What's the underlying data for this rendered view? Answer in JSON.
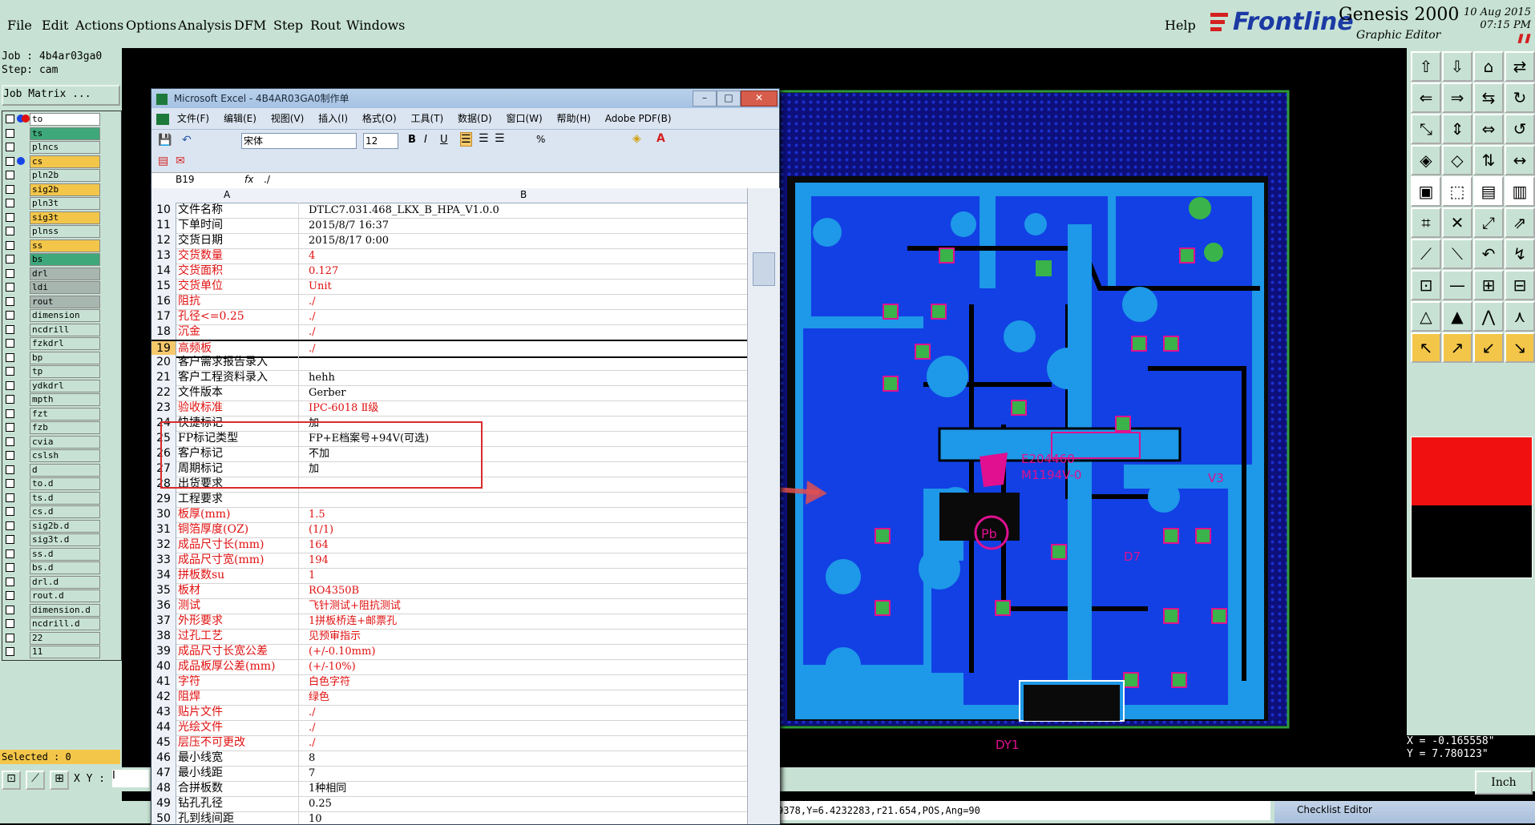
{
  "menubar": {
    "items": [
      "File",
      "Edit",
      "Actions",
      "Options",
      "Analysis",
      "DFM",
      "Step",
      "Rout",
      "Windows"
    ],
    "help": "Help",
    "brand": "Frontline",
    "product": "Genesis 2000",
    "subtitle": "Graphic Editor",
    "date": "10 Aug 2015",
    "time": "07:15 PM"
  },
  "left": {
    "job": "Job : 4b4ar03ga0",
    "step": "Step: cam",
    "job_matrix": "Job Matrix ...",
    "selected": "Selected : 0",
    "layers": [
      {
        "name": "to",
        "color": "#ffffff",
        "dot1": "#1846e6",
        "dot2": "#e01010"
      },
      {
        "name": "ts",
        "color": "#3fa87a"
      },
      {
        "name": "plncs",
        "color": "#c7e2d4"
      },
      {
        "name": "cs",
        "color": "#f3c64a",
        "dot1": "#1846e6"
      },
      {
        "name": "pln2b",
        "color": "#c7e2d4"
      },
      {
        "name": "sig2b",
        "color": "#f3c64a"
      },
      {
        "name": "pln3t",
        "color": "#c7e2d4"
      },
      {
        "name": "sig3t",
        "color": "#f3c64a"
      },
      {
        "name": "plnss",
        "color": "#c7e2d4"
      },
      {
        "name": "ss",
        "color": "#f3c64a"
      },
      {
        "name": "bs",
        "color": "#3fa87a"
      },
      {
        "name": "drl",
        "color": "#a8b6b0"
      },
      {
        "name": "ldi",
        "color": "#a8b6b0"
      },
      {
        "name": "rout",
        "color": "#a8b6b0"
      },
      {
        "name": "dimension",
        "color": "#c7e2d4"
      },
      {
        "name": "ncdrill",
        "color": "#c7e2d4"
      },
      {
        "name": "fzkdrl",
        "color": "#c7e2d4"
      },
      {
        "name": "bp",
        "color": "#c7e2d4"
      },
      {
        "name": "tp",
        "color": "#c7e2d4"
      },
      {
        "name": "ydkdrl",
        "color": "#c7e2d4"
      },
      {
        "name": "mpth",
        "color": "#c7e2d4"
      },
      {
        "name": "fzt",
        "color": "#c7e2d4"
      },
      {
        "name": "fzb",
        "color": "#c7e2d4"
      },
      {
        "name": "cvia",
        "color": "#c7e2d4"
      },
      {
        "name": "cslsh",
        "color": "#c7e2d4"
      },
      {
        "name": "d",
        "color": "#c7e2d4"
      },
      {
        "name": "to.d",
        "color": "#c7e2d4"
      },
      {
        "name": "ts.d",
        "color": "#c7e2d4"
      },
      {
        "name": "cs.d",
        "color": "#c7e2d4"
      },
      {
        "name": "sig2b.d",
        "color": "#c7e2d4"
      },
      {
        "name": "sig3t.d",
        "color": "#c7e2d4"
      },
      {
        "name": "ss.d",
        "color": "#c7e2d4"
      },
      {
        "name": "bs.d",
        "color": "#c7e2d4"
      },
      {
        "name": "drl.d",
        "color": "#c7e2d4"
      },
      {
        "name": "rout.d",
        "color": "#c7e2d4"
      },
      {
        "name": "dimension.d",
        "color": "#c7e2d4"
      },
      {
        "name": "ncdrill.d",
        "color": "#c7e2d4"
      },
      {
        "name": "22",
        "color": "#c7e2d4"
      },
      {
        "name": "11",
        "color": "#c7e2d4"
      }
    ]
  },
  "xy": {
    "label": "X Y :",
    "value": "I"
  },
  "coords": {
    "x": "X = -0.165558\"",
    "y": "Y = 7.780123\""
  },
  "units": "Inch",
  "cmdline": "9378,Y=6.4232283,r21.654,POS,Ang=90",
  "checklist_title": "Checklist Editor",
  "pcb": {
    "labels": [
      "E204460",
      "M1194V-0",
      "V3",
      "D7",
      "DY1"
    ]
  },
  "excel": {
    "title": "Microsoft Excel - 4B4AR03GA0制作单",
    "menus": [
      "文件(F)",
      "编辑(E)",
      "视图(V)",
      "插入(I)",
      "格式(O)",
      "工具(T)",
      "数据(D)",
      "窗口(W)",
      "帮助(H)",
      "Adobe PDF(B)"
    ],
    "font": "宋体",
    "size": "12",
    "cellref": "B19",
    "formula": "./",
    "col_a": "A",
    "col_b": "B",
    "rows": [
      {
        "n": "10",
        "a": "文件名称",
        "b": "DTLC7.031.468_LKX_B_HPA_V1.0.0",
        "red": false
      },
      {
        "n": "11",
        "a": "下单时间",
        "b": "2015/8/7 16:37",
        "red": false
      },
      {
        "n": "12",
        "a": "交货日期",
        "b": "2015/8/17 0:00",
        "red": false
      },
      {
        "n": "13",
        "a": "交货数量",
        "b": "4",
        "red": true
      },
      {
        "n": "14",
        "a": "交货面积",
        "b": "0.127",
        "red": true
      },
      {
        "n": "15",
        "a": "交货单位",
        "b": "Unit",
        "red": true
      },
      {
        "n": "16",
        "a": "阻抗",
        "b": "./",
        "red": true
      },
      {
        "n": "17",
        "a": "孔径<=0.25",
        "b": "./",
        "red": true
      },
      {
        "n": "18",
        "a": "沉金",
        "b": "./",
        "red": true
      },
      {
        "n": "19",
        "a": "高频板",
        "b": "./",
        "red": true
      },
      {
        "n": "20",
        "a": "客户需求报告录入",
        "b": "",
        "red": false
      },
      {
        "n": "21",
        "a": "客户工程资料录入",
        "b": "hehh",
        "red": false
      },
      {
        "n": "22",
        "a": "文件版本",
        "b": "Gerber",
        "red": false
      },
      {
        "n": "23",
        "a": "验收标准",
        "b": "IPC-6018 Ⅱ级",
        "red": true
      },
      {
        "n": "24",
        "a": "快捷标记",
        "b": "加",
        "red": false
      },
      {
        "n": "25",
        "a": "FP标记类型",
        "b": "FP+E档案号+94V(可选)",
        "red": false
      },
      {
        "n": "26",
        "a": "客户标记",
        "b": "不加",
        "red": false
      },
      {
        "n": "27",
        "a": "周期标记",
        "b": "加",
        "red": false
      },
      {
        "n": "28",
        "a": "出货要求",
        "b": "",
        "red": false
      },
      {
        "n": "29",
        "a": "工程要求",
        "b": "",
        "red": false
      },
      {
        "n": "30",
        "a": "板厚(mm)",
        "b": "1.5",
        "red": true
      },
      {
        "n": "31",
        "a": "铜箔厚度(OZ)",
        "b": "(1/1)",
        "red": true
      },
      {
        "n": "32",
        "a": "成品尺寸长(mm)",
        "b": "164",
        "red": true
      },
      {
        "n": "33",
        "a": "成品尺寸宽(mm)",
        "b": "194",
        "red": true
      },
      {
        "n": "34",
        "a": "拼板数su",
        "b": "1",
        "red": true
      },
      {
        "n": "35",
        "a": "板材",
        "b": "RO4350B",
        "red": true
      },
      {
        "n": "36",
        "a": "测试",
        "b": "飞针测试+阻抗测试",
        "red": true
      },
      {
        "n": "37",
        "a": "外形要求",
        "b": "1拼板桥连+邮票孔",
        "red": true
      },
      {
        "n": "38",
        "a": "过孔工艺",
        "b": "见预审指示",
        "red": true
      },
      {
        "n": "39",
        "a": "成品尺寸长宽公差",
        "b": "(+/-0.10mm)",
        "red": true
      },
      {
        "n": "40",
        "a": "成品板厚公差(mm)",
        "b": "(+/-10%)",
        "red": true
      },
      {
        "n": "41",
        "a": "字符",
        "b": "白色字符",
        "red": true
      },
      {
        "n": "42",
        "a": "阻焊",
        "b": "绿色",
        "red": true
      },
      {
        "n": "43",
        "a": "贴片文件",
        "b": "./",
        "red": true
      },
      {
        "n": "44",
        "a": "光绘文件",
        "b": "./",
        "red": true
      },
      {
        "n": "45",
        "a": "层压不可更改",
        "b": "./",
        "red": true
      },
      {
        "n": "46",
        "a": "最小线宽",
        "b": "8",
        "red": false
      },
      {
        "n": "47",
        "a": "最小线距",
        "b": "7",
        "red": false
      },
      {
        "n": "48",
        "a": "合拼板数",
        "b": "1种相同",
        "red": false
      },
      {
        "n": "49",
        "a": "钻孔孔径",
        "b": "0.25",
        "red": false
      },
      {
        "n": "50",
        "a": "孔到线间距",
        "b": "10",
        "red": false
      }
    ]
  }
}
